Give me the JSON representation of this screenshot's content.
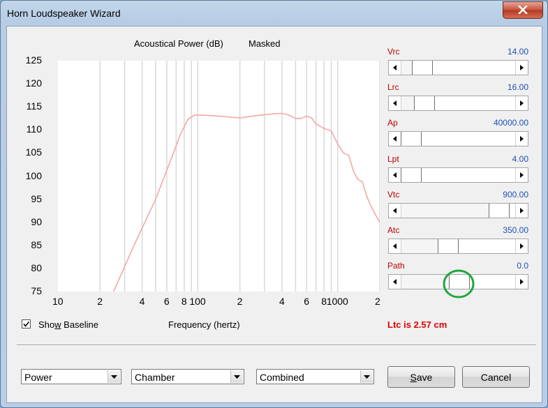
{
  "window": {
    "title": "Horn Loudspeaker Wizard"
  },
  "chart_data": {
    "type": "line",
    "title": "Acoustical Power (dB)",
    "subtitle": "Masked",
    "xlabel": "Frequency (hertz)",
    "ylabel": "",
    "x_scale": "log",
    "xlim": [
      10,
      2000
    ],
    "ylim": [
      75,
      125
    ],
    "y_ticks": [
      125,
      120,
      115,
      110,
      105,
      100,
      95,
      90,
      85,
      80,
      75
    ],
    "x_tick_labels": [
      "10",
      "2",
      "4",
      "6",
      "8",
      "100",
      "2",
      "4",
      "6",
      "8",
      "1000",
      "2"
    ],
    "grid": true,
    "series": [
      {
        "color": "#f4a8a8",
        "x": [
          25,
          35,
          50,
          65,
          75,
          85,
          95,
          110,
          140,
          200,
          280,
          350,
          400,
          450,
          500,
          550,
          600,
          650,
          700,
          800,
          900,
          1000,
          1100,
          1200,
          1300,
          1400,
          1500,
          1600,
          1700,
          1800,
          2000
        ],
        "y": [
          75,
          85,
          95,
          104,
          109,
          112.3,
          113.2,
          113.2,
          113,
          112.6,
          113.2,
          113.5,
          113.6,
          113.2,
          112.5,
          112.5,
          113,
          112.6,
          111.3,
          110.3,
          109.8,
          107,
          105,
          104.5,
          101,
          99.2,
          98.8,
          96,
          94,
          92.5,
          90
        ]
      }
    ]
  },
  "params": [
    {
      "name": "Vrc",
      "value": "14.00",
      "pos": 0.12
    },
    {
      "name": "Lrc",
      "value": "16.00",
      "pos": 0.14
    },
    {
      "name": "Ap",
      "value": "40000.00",
      "pos": 0.0
    },
    {
      "name": "Lpt",
      "value": "4.00",
      "pos": 0.0
    },
    {
      "name": "Vtc",
      "value": "900.00",
      "pos": 0.92
    },
    {
      "name": "Atc",
      "value": "350.00",
      "pos": 0.39
    },
    {
      "name": "Path",
      "value": "0.0",
      "pos": 0.5
    }
  ],
  "baseline": {
    "label_pre": "Sho",
    "label_acc": "w",
    "label_post": " Baseline",
    "checked": true
  },
  "status_text": "Ltc is 2.57 cm",
  "dropdowns": [
    "Power",
    "Chamber",
    "Combined"
  ],
  "buttons": {
    "save_acc": "S",
    "save_rest": "ave",
    "cancel": "Cancel"
  },
  "colors": {
    "highlight_circle": "#22a640",
    "param_name": "#c00000",
    "param_value": "#1f50b8"
  }
}
